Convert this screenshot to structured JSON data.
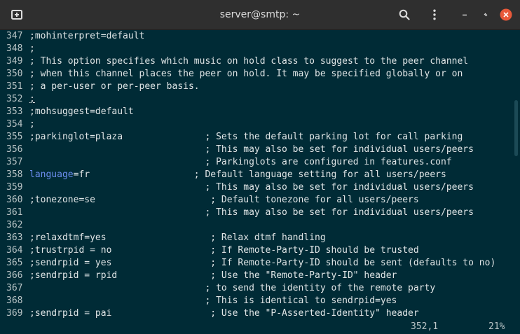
{
  "window": {
    "title": "server@smtp: ~",
    "new_tab_icon": "new-tab-icon",
    "search_icon": "search-icon",
    "menu_icon": "kebab-menu-icon",
    "minimize_icon": "minimize-icon",
    "restore_icon": "restore-icon",
    "close_icon": "close-icon",
    "close_color": "#e8593a"
  },
  "terminal": {
    "colors": {
      "background": "#002b36",
      "text": "#dfe5e6",
      "line_number": "#b8c4c6",
      "keyword": "#6c8ef0"
    },
    "lines": [
      {
        "num": "347",
        "pre": ";mohinterpret=default",
        "kw": "",
        "post": ""
      },
      {
        "num": "348",
        "pre": ";",
        "kw": "",
        "post": ""
      },
      {
        "num": "349",
        "pre": "; This option specifies which music on hold class to suggest to the peer channel",
        "kw": "",
        "post": ""
      },
      {
        "num": "350",
        "pre": "; when this channel places the peer on hold. It may be specified globally or on",
        "kw": "",
        "post": ""
      },
      {
        "num": "351",
        "pre": "; a per-user or per-peer basis.",
        "kw": "",
        "post": ""
      },
      {
        "num": "352",
        "pre": ";",
        "kw": "",
        "post": "",
        "cursor": true
      },
      {
        "num": "353",
        "pre": ";mohsuggest=default",
        "kw": "",
        "post": ""
      },
      {
        "num": "354",
        "pre": ";",
        "kw": "",
        "post": ""
      },
      {
        "num": "355",
        "pre": ";parkinglot=plaza               ; Sets the default parking lot for call parking",
        "kw": "",
        "post": ""
      },
      {
        "num": "356",
        "pre": "                                ; This may also be set for individual users/peers",
        "kw": "",
        "post": ""
      },
      {
        "num": "357",
        "pre": "                                ; Parkinglots are configured in features.conf",
        "kw": "",
        "post": ""
      },
      {
        "num": "358",
        "pre": "",
        "kw": "language",
        "post": "=fr                   ; Default language setting for all users/peers"
      },
      {
        "num": "359",
        "pre": "                                ; This may also be set for individual users/peers",
        "kw": "",
        "post": ""
      },
      {
        "num": "360",
        "pre": ";tonezone=se                     ; Default tonezone for all users/peers",
        "kw": "",
        "post": ""
      },
      {
        "num": "361",
        "pre": "                                ; This may also be set for individual users/peers",
        "kw": "",
        "post": ""
      },
      {
        "num": "362",
        "pre": "",
        "kw": "",
        "post": ""
      },
      {
        "num": "363",
        "pre": ";relaxdtmf=yes                   ; Relax dtmf handling",
        "kw": "",
        "post": ""
      },
      {
        "num": "364",
        "pre": ";trustrpid = no                  ; If Remote-Party-ID should be trusted",
        "kw": "",
        "post": ""
      },
      {
        "num": "365",
        "pre": ";sendrpid = yes                  ; If Remote-Party-ID should be sent (defaults to no)",
        "kw": "",
        "post": ""
      },
      {
        "num": "366",
        "pre": ";sendrpid = rpid                 ; Use the \"Remote-Party-ID\" header",
        "kw": "",
        "post": ""
      },
      {
        "num": "367",
        "pre": "                                ; to send the identity of the remote party",
        "kw": "",
        "post": ""
      },
      {
        "num": "368",
        "pre": "                                ; This is identical to sendrpid=yes",
        "kw": "",
        "post": ""
      },
      {
        "num": "369",
        "pre": ";sendrpid = pai                  ; Use the \"P-Asserted-Identity\" header",
        "kw": "",
        "post": ""
      }
    ],
    "status": {
      "position": "352,1",
      "percent": "21%"
    }
  }
}
